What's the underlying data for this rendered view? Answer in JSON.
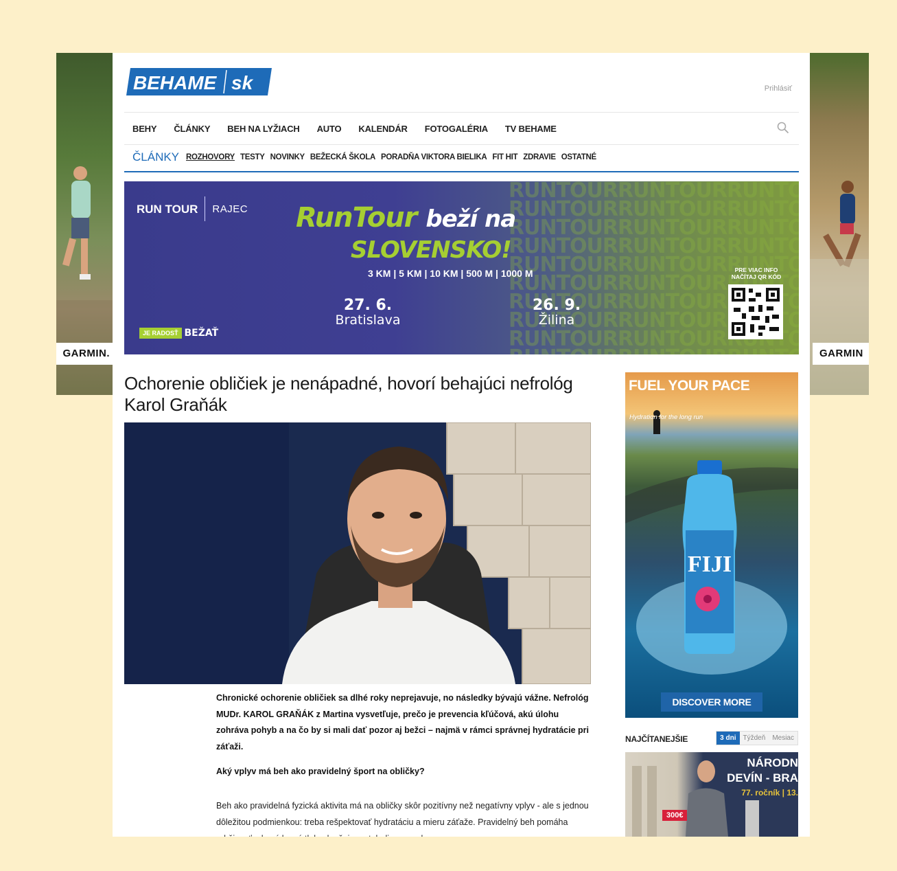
{
  "site": {
    "logo_text": "BEHAME",
    "logo_suffix": "sk",
    "login": "Prihlásiť",
    "nav": [
      "BEHY",
      "ČLÁNKY",
      "BEH NA LYŽIACH",
      "AUTO",
      "KALENDÁR",
      "FOTOGALÉRIA",
      "TV BEHAME"
    ],
    "section_title": "ČLÁNKY",
    "subnav": [
      "ROZHOVORY",
      "TESTY",
      "NOVINKY",
      "BEŽECKÁ ŠKOLA",
      "PORADŇA VIKTORA BIELIKA",
      "FIT HIT",
      "ZDRAVIE",
      "OSTATNÉ"
    ],
    "subnav_active": "ROZHOVORY"
  },
  "skins": {
    "left_brand": "GARMIN.",
    "right_brand": "GARMIN"
  },
  "banner": {
    "logo_runtour": "RUN TOUR",
    "logo_rajec": "RAJEC",
    "headline_green": "RunTour",
    "headline_white": "beží na",
    "headline_line2": "SLOVENSKO!",
    "distances": "3 KM | 5 KM | 10 KM | 500 M | 1000 M",
    "events": [
      {
        "date": "27. 6.",
        "city": "Bratislava"
      },
      {
        "date": "26. 9.",
        "city": "Žilina"
      }
    ],
    "qr_info": "PRE VIAC INFO NAČÍTAJ QR KÓD",
    "slogan_tag": "JE RADOSŤ",
    "slogan_word": "BEŽAŤ",
    "watermark": "RUNTOUR"
  },
  "article": {
    "title": "Ochorenie obličiek je nenápadné, hovorí behajúci nefrológ Karol Graňák",
    "lead": "Chronické ochorenie obličiek sa dlhé roky neprejavuje, no následky bývajú vážne. Nefrológ MUDr. KAROL GRAŇÁK z Martina vysvetľuje, prečo je prevencia kľúčová, akú úlohu zohráva pohyb a na čo by si mali dať pozor aj bežci – najmä v rámci správnej hydratácie pri záťaži.",
    "question": "Aký vplyv má beh ako pravidelný šport na obličky?",
    "body": "Beh ako pravidelná fyzická aktivita má na obličky skôr pozitívny než negatívny vplyv - ale s jednou dôležitou podmienkou: treba rešpektovať hydratáciu a mieru záťaže. Pravidelný beh pomáha udržiavať zdravý krvný tlak, zlepšuje metabolizmus cukrov a"
  },
  "sidebar_ad": {
    "headline": "FUEL YOUR PACE",
    "subline": "Hydration for the long run",
    "bottle_brand": "FIJI",
    "cta": "DISCOVER MORE"
  },
  "popular": {
    "title": "NAJČÍTANEJŠIE",
    "tabs": [
      "3 dni",
      "Týždeň",
      "Mesiac"
    ],
    "active_tab": "3 dni",
    "thumb_line1": "NÁRODN",
    "thumb_line2": "DEVÍN - BRA",
    "thumb_line3": "77. ročník | 13.",
    "thumb_tag": "300€"
  },
  "colors": {
    "page_bg": "#fdf0c9",
    "brand_blue": "#1e6bb8",
    "banner_purple": "#3f3f92",
    "banner_green": "#a6cf32"
  }
}
